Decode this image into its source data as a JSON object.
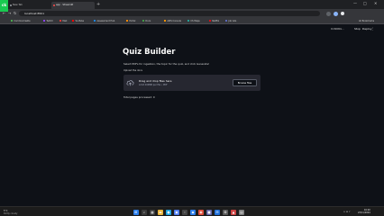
{
  "browser": {
    "tabs": [
      {
        "label": "New Tab",
        "active": false
      },
      {
        "label": "app · Streamlit",
        "active": true
      }
    ],
    "new_tab_glyph": "+",
    "window_controls": [
      "—",
      "□",
      "✕"
    ],
    "url": "localhost:8501",
    "bookmarks": [
      {
        "label": "CommonCastle",
        "color": "#4caf50"
      },
      {
        "label": "Twitch",
        "color": "#9146ff"
      },
      {
        "label": "Mail",
        "color": "#e53935"
      },
      {
        "label": "YouTube",
        "color": "#ff0000"
      },
      {
        "label": "Assessment Hub",
        "color": "#1e88e5"
      },
      {
        "label": "Portal",
        "color": "#fb8c00"
      },
      {
        "label": "Docs",
        "color": "#43a047"
      },
      {
        "label": "AWS Console",
        "color": "#ff9900"
      },
      {
        "label": "CS Maps",
        "color": "#26a69a"
      },
      {
        "label": "Netflix",
        "color": "#e50914"
      },
      {
        "label": "Job Ads",
        "color": "#5c6bc0"
      }
    ],
    "all_bookmarks": "All Bookmarks"
  },
  "corner_logo": "ck",
  "app_header": {
    "running_label": "RUNNING...",
    "stop_label": "Stop",
    "deploy_label": "Deploy",
    "menu_glyph": "⋮"
  },
  "main": {
    "title": "Quiz Builder",
    "description": "Select PDFs for ingestion, the topic for the quiz, and click Generate!",
    "upload_label": "Upload the docs",
    "dropzone": {
      "main_text": "Drag and drop files here",
      "sub_text": "Limit 200MB per file • PDF",
      "browse_label": "Browse files"
    },
    "total_pages": "Total pages processed: 0"
  },
  "taskbar": {
    "weather_temp": "5°C",
    "weather_desc": "Partly cloudy",
    "time": "16:20",
    "date": "23/11/2024",
    "apps": [
      {
        "name": "windows-start-icon",
        "glyph": "⊞",
        "color": "#2b7de9"
      },
      {
        "name": "search-icon",
        "glyph": "⌕",
        "color": "#3a3a3a"
      },
      {
        "name": "widgets-icon",
        "glyph": "▦",
        "color": "#3a3a3a"
      },
      {
        "name": "file-explorer-icon",
        "glyph": "▬",
        "color": "#e8b33b"
      },
      {
        "name": "edge-icon",
        "glyph": "●",
        "color": "#1fa3e0"
      },
      {
        "name": "store-icon",
        "glyph": "▣",
        "color": "#4d7cf2"
      },
      {
        "name": "terminal-icon",
        "glyph": "›",
        "color": "#444444"
      },
      {
        "name": "vscode-icon",
        "glyph": "◆",
        "color": "#2f80ed"
      },
      {
        "name": "chrome-icon",
        "glyph": "◉",
        "color": "#dd4b39"
      },
      {
        "name": "teams-icon",
        "glyph": "■",
        "color": "#6264a7"
      },
      {
        "name": "mail-icon",
        "glyph": "✉",
        "color": "#1e6fd9"
      },
      {
        "name": "settings-icon",
        "glyph": "⚙",
        "color": "#5a5a5a"
      },
      {
        "name": "photos-icon",
        "glyph": "▲",
        "color": "#cc4040"
      },
      {
        "name": "notes-icon",
        "glyph": "▤",
        "color": "#7a7a7a"
      }
    ],
    "tray": "∧  ☷  ♪"
  }
}
